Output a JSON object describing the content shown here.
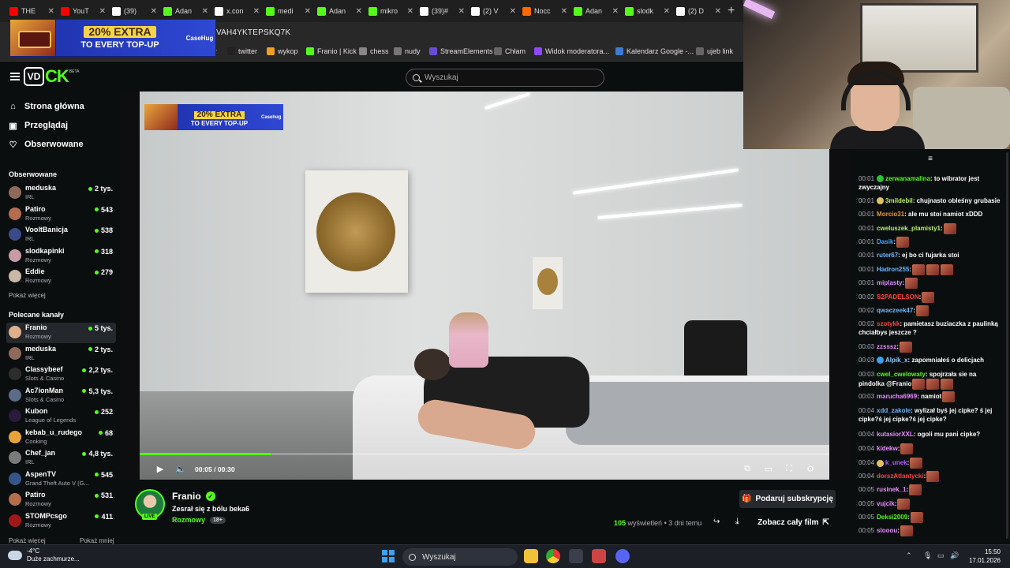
{
  "browser": {
    "tabs": [
      {
        "icon": "youtube-icon",
        "color": "#ff0000",
        "label": "THE"
      },
      {
        "icon": "youtube-icon",
        "color": "#ff0000",
        "label": "YouT"
      },
      {
        "icon": "tiktok-icon",
        "color": "#ffffff",
        "label": "(39)"
      },
      {
        "icon": "kick-icon",
        "color": "#53fc18",
        "label": "Adan"
      },
      {
        "icon": "x-icon",
        "color": "#ffffff",
        "label": "x.con"
      },
      {
        "icon": "kick-icon",
        "color": "#53fc18",
        "label": "medi"
      },
      {
        "icon": "kick-icon",
        "color": "#53fc18",
        "label": "Adan"
      },
      {
        "icon": "kick-icon",
        "color": "#53fc18",
        "label": "mikro"
      },
      {
        "icon": "tiktok-icon",
        "color": "#ffffff",
        "label": "(39)#"
      },
      {
        "icon": "x-icon",
        "color": "#ffffff",
        "label": "(2) V"
      },
      {
        "icon": "amazon-icon",
        "color": "#ff6a00",
        "label": "Nocc"
      },
      {
        "icon": "kick-icon",
        "color": "#53fc18",
        "label": "Adan"
      },
      {
        "icon": "kick-icon",
        "color": "#53fc18",
        "label": "slodk"
      },
      {
        "icon": "x-icon",
        "color": "#ffffff",
        "label": "(2) D"
      }
    ],
    "url": "VAH4YKTEPSKQ7K",
    "bookmarks": [
      {
        "label": "r",
        "icon": ""
      },
      {
        "label": "twitter",
        "icon": "x-icon"
      },
      {
        "label": "wykop",
        "icon": "wykop-icon"
      },
      {
        "label": "Franio | Kick",
        "icon": "kick-icon"
      },
      {
        "label": "chess",
        "icon": "chess-icon"
      },
      {
        "label": "nudy",
        "icon": "folder-icon"
      },
      {
        "label": "StreamElements",
        "icon": "streamelements-icon"
      },
      {
        "label": "Chłam",
        "icon": "globe-icon"
      },
      {
        "label": "Widok moderatora...",
        "icon": "twitch-icon"
      },
      {
        "label": "Kalendarz Google -...",
        "icon": "calendar-icon"
      },
      {
        "label": "ujeb link",
        "icon": "globe-icon"
      }
    ]
  },
  "ad": {
    "line1": "20% EXTRA",
    "line2": "TO EVERY TOP-UP",
    "brand": "CaseHug"
  },
  "header": {
    "logo_box": "VD",
    "logo_text": "CK",
    "logo_badge": "BETA",
    "search_placeholder": "Wyszukaj"
  },
  "sidebar": {
    "nav": [
      {
        "label": "Strona główna",
        "icon": "home-icon"
      },
      {
        "label": "Przeglądaj",
        "icon": "browse-icon"
      },
      {
        "label": "Obserwowane",
        "icon": "heart-icon"
      }
    ],
    "followed_title": "Obserwowane",
    "followed": [
      {
        "name": "meduska",
        "category": "IRL",
        "viewers": "2 tys.",
        "color": "#8e6a5a"
      },
      {
        "name": "Patiro",
        "category": "Rozmowy",
        "viewers": "543",
        "color": "#b56d4d"
      },
      {
        "name": "VooltBanicja",
        "category": "IRL",
        "viewers": "538",
        "color": "#3b4a8a"
      },
      {
        "name": "slodkapinki",
        "category": "Rozmowy",
        "viewers": "318",
        "color": "#c79aa6"
      },
      {
        "name": "Eddie",
        "category": "Rozmowy",
        "viewers": "279",
        "color": "#c9b7a8"
      }
    ],
    "show_more": "Pokaż więcej",
    "recommended_title": "Polecane kanały",
    "recommended": [
      {
        "name": "Franio",
        "category": "Rozmowy",
        "viewers": "5 tys.",
        "color": "#e0b08c"
      },
      {
        "name": "meduska",
        "category": "IRL",
        "viewers": "2 tys.",
        "color": "#8e6a5a"
      },
      {
        "name": "Classybeef",
        "category": "Slots & Casino",
        "viewers": "2,2 tys.",
        "color": "#2d2d2d"
      },
      {
        "name": "Ac7ionMan",
        "category": "Slots & Casino",
        "viewers": "5,3 tys.",
        "color": "#5b6c8a"
      },
      {
        "name": "Kubon",
        "category": "League of Legends",
        "viewers": "252",
        "color": "#2a1b3d"
      },
      {
        "name": "kebab_u_rudego",
        "category": "Cooking",
        "viewers": "68",
        "color": "#e8a33c"
      },
      {
        "name": "Chef_jan",
        "category": "IRL",
        "viewers": "4,8 tys.",
        "color": "#7a7a7a"
      },
      {
        "name": "AspenTV",
        "category": "Grand Theft Auto V (G...",
        "viewers": "545",
        "color": "#35548a"
      },
      {
        "name": "Patiro",
        "category": "Rozmowy",
        "viewers": "531",
        "color": "#b56d4d"
      },
      {
        "name": "STOMPcsgo",
        "category": "Rozmowy",
        "viewers": "411",
        "color": "#a01818"
      }
    ],
    "show_less": "Pokaż mniej"
  },
  "video": {
    "ad_line1": "20% EXTRA",
    "ad_line2": "TO EVERY TOP-UP",
    "ad_brand": "Casehug",
    "current_time": "00:05",
    "separator": "/",
    "duration": "00:30",
    "progress": 0.19
  },
  "info": {
    "live_badge": "LIVE",
    "streamer": "Franio",
    "title": "Zesrał się z bólu beka6",
    "category": "Rozmowy",
    "age": "18+",
    "subscribe_label": "Podaruj subskrypcję",
    "views_count": "105",
    "views_label": "wyświetleń",
    "dot": "•",
    "posted": "3 dni temu",
    "full_video_label": "Zobacz cały film"
  },
  "chat": {
    "messages": [
      {
        "time": "00:01",
        "user": "zerwanamalina",
        "color": "#53fc18",
        "badge": "#2fbf3a",
        "text": ": to wibrator jest zwyczajny",
        "emotes": 0
      },
      {
        "time": "00:01",
        "user": "3mildebil",
        "color": "#b6f06a",
        "badge": "#e0c25a",
        "text": ": chujnasto obleśny grubasie",
        "emotes": 0
      },
      {
        "time": "00:01",
        "user": "Morcio31",
        "color": "#e8943a",
        "badge": "",
        "text": ": ale mu stoi namiot xDDD",
        "emotes": 0
      },
      {
        "time": "00:01",
        "user": "cweluszek_plamisty1",
        "color": "#b6f06a",
        "badge": "",
        "text": ":",
        "emotes": 1
      },
      {
        "time": "00:01",
        "user": "Dasik",
        "color": "#4aa3ff",
        "badge": "",
        "text": ":",
        "emotes": 1
      },
      {
        "time": "00:01",
        "user": "ruter67",
        "color": "#6ab6ff",
        "badge": "",
        "text": ": ej bo ci fujarka stoi",
        "emotes": 0
      },
      {
        "time": "00:01",
        "user": "Hadron255",
        "color": "#6ab6ff",
        "badge": "",
        "text": ":",
        "emotes": 3
      },
      {
        "time": "00:01",
        "user": "miplasty",
        "color": "#d88cff",
        "badge": "",
        "text": ":",
        "emotes": 1
      },
      {
        "time": "00:02",
        "user": "S2PADELSON",
        "color": "#ff4040",
        "badge": "",
        "text": ":",
        "emotes": 1
      },
      {
        "time": "00:02",
        "user": "qwaczeek47",
        "color": "#6ab6ff",
        "badge": "",
        "text": ":",
        "emotes": 1
      },
      {
        "time": "00:02",
        "user": "szotykk",
        "color": "#ff4040",
        "badge": "",
        "text": ": pamietasz buziaczka z paulinką chciałbys jeszcze ?",
        "emotes": 0
      },
      {
        "time": "00:03",
        "user": "zzsssz",
        "color": "#e88cff",
        "badge": "",
        "text": ":",
        "emotes": 1
      },
      {
        "time": "00:03",
        "user": "Alpik_x",
        "color": "#8cd0ff",
        "badge": "#3aa0f0",
        "text": ": zapomniałeś o delicjach",
        "emotes": 0
      },
      {
        "time": "00:03",
        "user": "cwel_cwelowaty",
        "color": "#53fc18",
        "badge": "",
        "text": ": spojrzała sie na pindolka @Franio",
        "emotes": 3
      },
      {
        "time": "00:03",
        "user": "marucha6969",
        "color": "#e88cff",
        "badge": "",
        "text": ": namiot",
        "emotes": 1
      },
      {
        "time": "00:04",
        "user": "xdd_zakole",
        "color": "#6ab6ff",
        "badge": "",
        "text": ": wylizał byś jej cipke? ś jej cipke?ś jej cipke?ś jej cipke?",
        "emotes": 0
      },
      {
        "time": "00:04",
        "user": "kutasiorXXL",
        "color": "#e88cff",
        "badge": "",
        "text": ": ogoli mu pani cipke?",
        "emotes": 0
      },
      {
        "time": "00:04",
        "user": "kidekw",
        "color": "#e88cff",
        "badge": "",
        "text": ":",
        "emotes": 1
      },
      {
        "time": "00:04",
        "user": "k_unek",
        "color": "#b65cff",
        "badge": "#e0c25a",
        "text": ":",
        "emotes": 1
      },
      {
        "time": "00:04",
        "user": "dorszAtlantycki",
        "color": "#ff4040",
        "badge": "",
        "text": ":",
        "emotes": 1
      },
      {
        "time": "00:05",
        "user": "rusinek_1",
        "color": "#e88cff",
        "badge": "",
        "text": ":",
        "emotes": 1
      },
      {
        "time": "00:05",
        "user": "vujcik",
        "color": "#e88cff",
        "badge": "",
        "text": ":",
        "emotes": 1
      },
      {
        "time": "00:05",
        "user": "Deksi2009",
        "color": "#53fc18",
        "badge": "",
        "text": ":",
        "emotes": 1
      },
      {
        "time": "00:05",
        "user": "slooou",
        "color": "#e88cff",
        "badge": "",
        "text": ":",
        "emotes": 1
      }
    ]
  },
  "taskbar": {
    "temp": "-4°C",
    "weather": "Duże zachmurze...",
    "search_placeholder": "Wyszukaj",
    "time": "15:50",
    "date": "17.01.2026"
  }
}
